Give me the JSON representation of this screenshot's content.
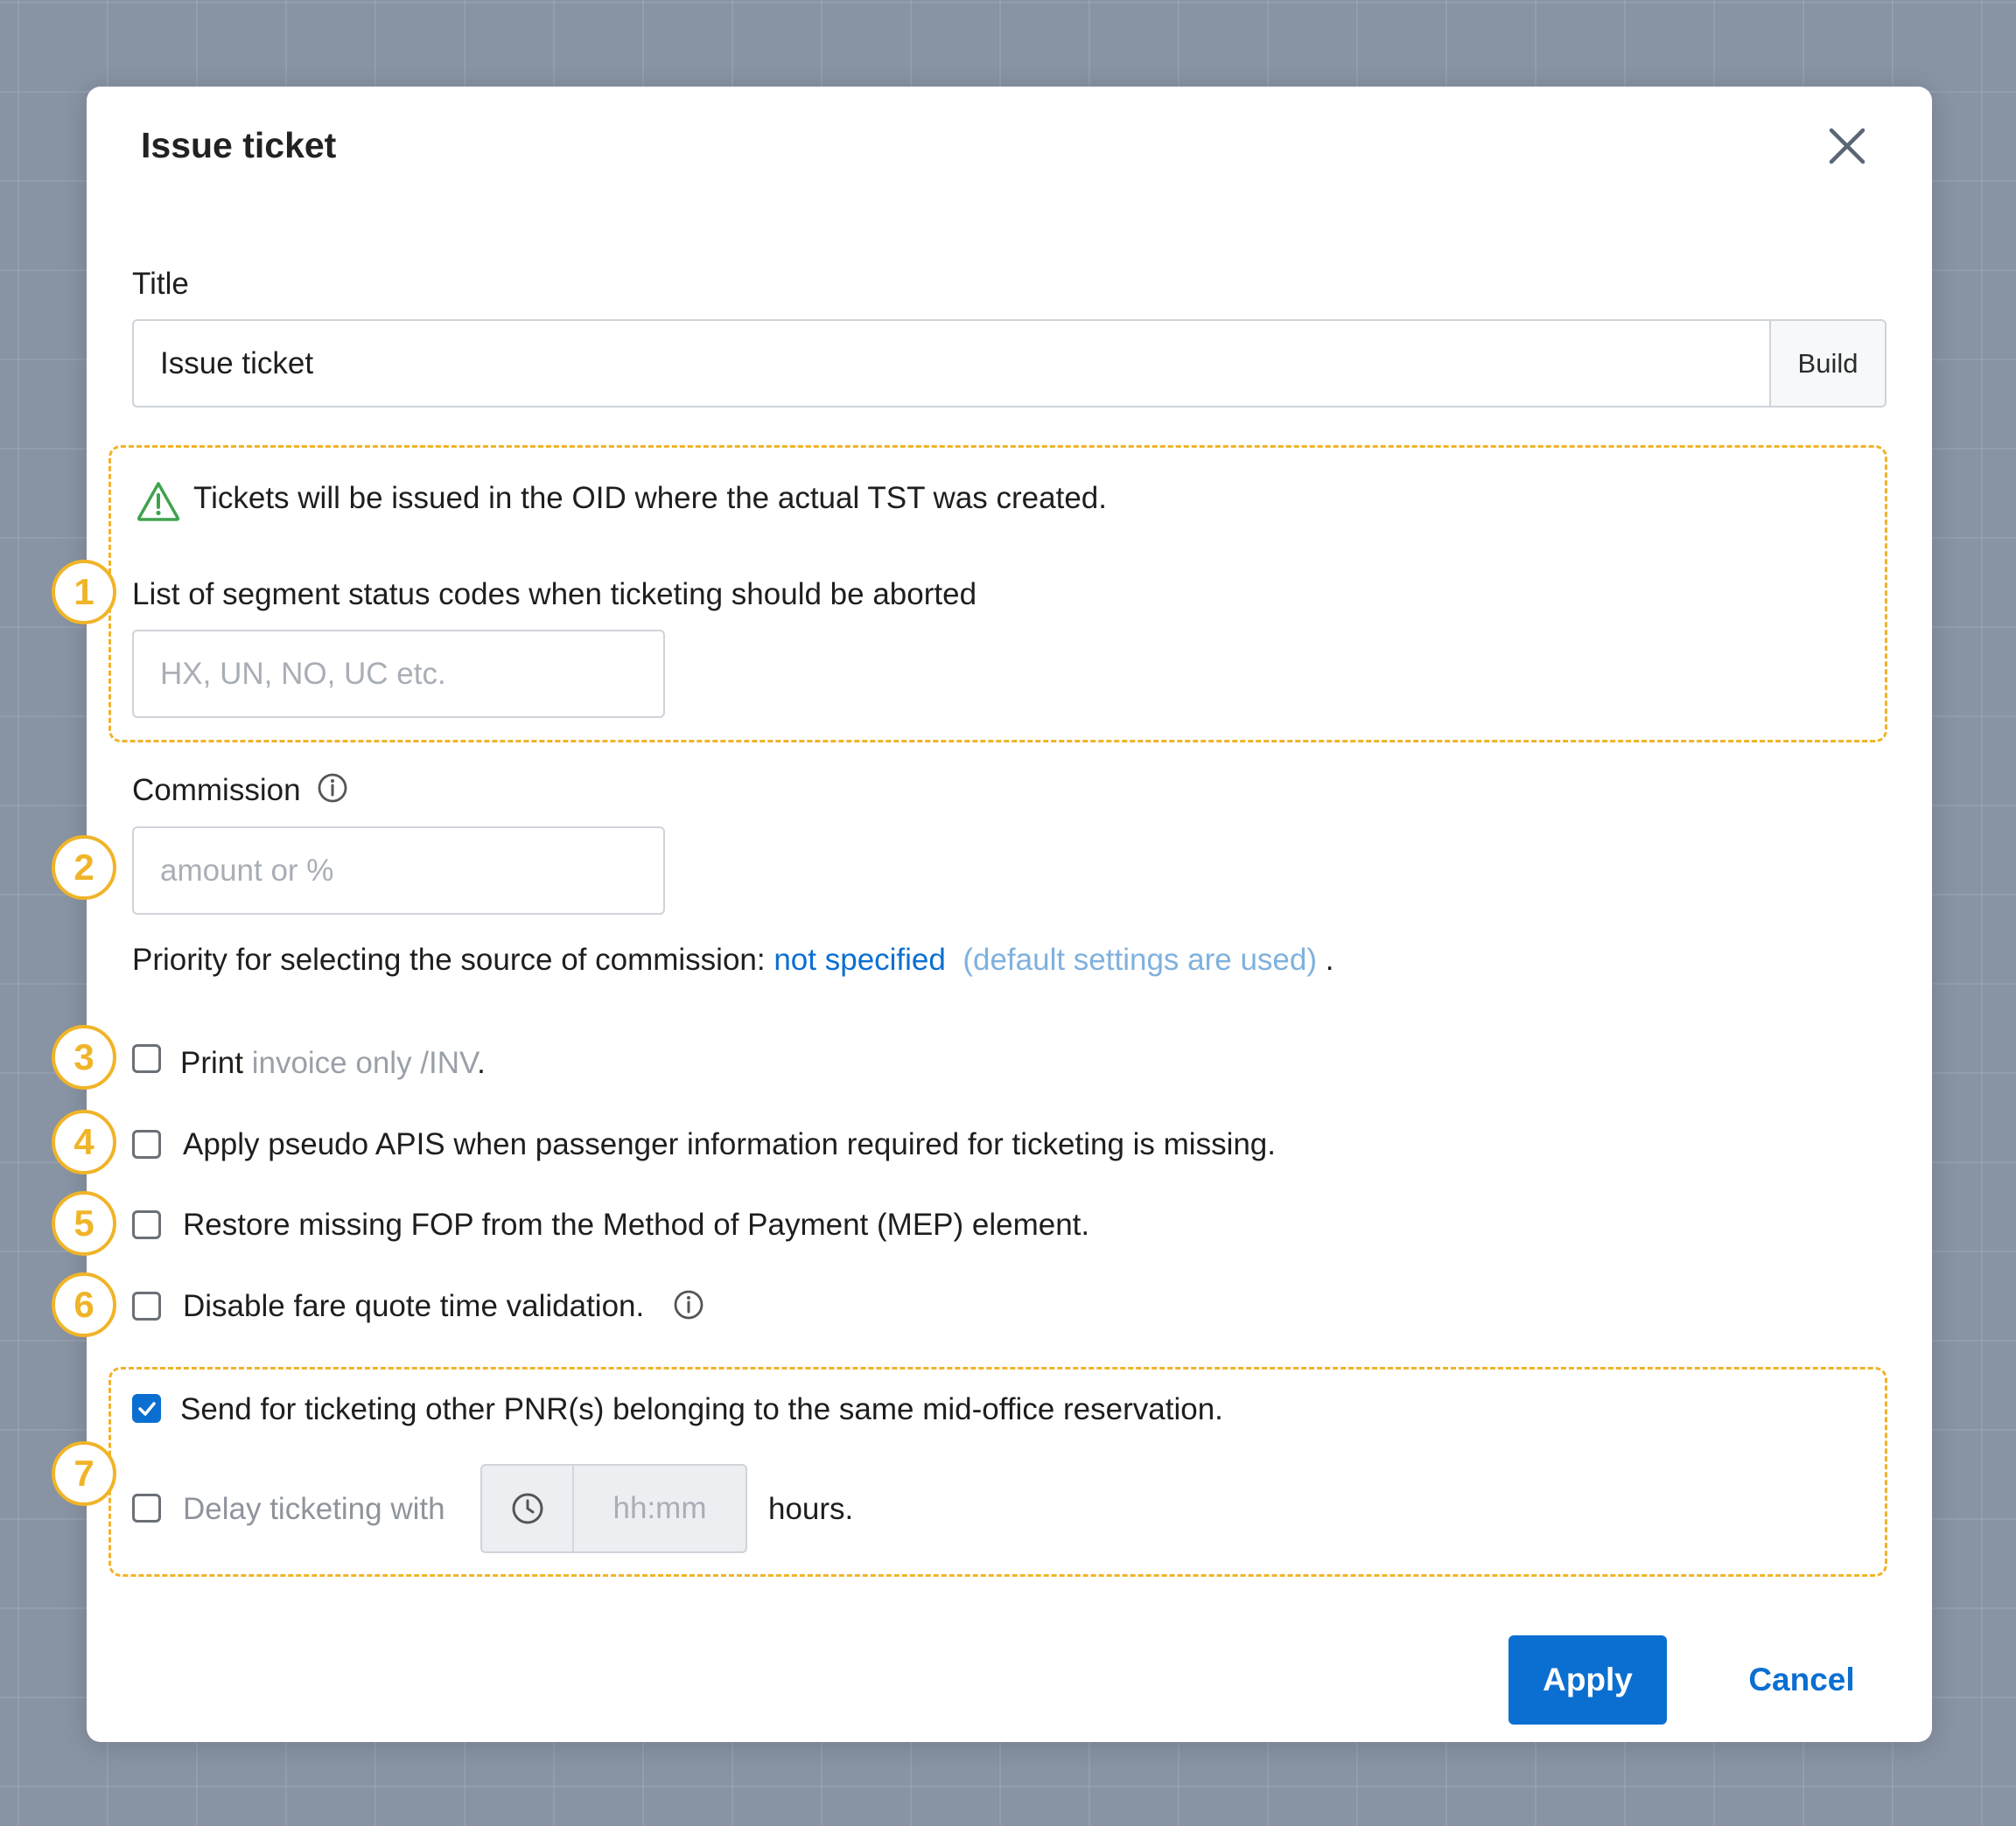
{
  "modal": {
    "title": "Issue ticket",
    "close_icon": "close-icon"
  },
  "title_field": {
    "label": "Title",
    "value": "Issue ticket",
    "build_label": "Build"
  },
  "notice": {
    "icon": "warning-triangle-icon",
    "text": "Tickets will be issued in the OID where the actual TST was created."
  },
  "segment_status": {
    "badge": "1",
    "label": "List of segment status codes when ticketing should be aborted",
    "placeholder": "HX, UN, NO, UC etc."
  },
  "commission": {
    "badge": "2",
    "label": "Commission",
    "info_icon": "info-icon",
    "placeholder": "amount or %",
    "priority_prefix": "Priority for selecting the source of commission:",
    "priority_link": "not specified",
    "priority_note": "(default settings are used)",
    "priority_suffix": "."
  },
  "options": {
    "print": {
      "badge": "3",
      "label": "Print",
      "muted": "invoice only /INV",
      "suffix": ".",
      "checked": false
    },
    "pseudo_apis": {
      "badge": "4",
      "label": "Apply pseudo APIS when passenger information required for ticketing is missing.",
      "checked": false
    },
    "restore_fop": {
      "badge": "5",
      "label": "Restore missing FOP from the Method of Payment (MEP) element.",
      "checked": false
    },
    "disable_fare_quote": {
      "badge": "6",
      "label": "Disable fare quote time validation.",
      "checked": false
    }
  },
  "mid_office": {
    "badge": "7",
    "send_label": "Send for ticketing other PNR(s) belonging to the same mid-office reservation.",
    "send_checked": true,
    "delay_label": "Delay ticketing with",
    "delay_checked": false,
    "time_placeholder": "hh:mm",
    "hours_label": "hours.",
    "clock_icon": "clock-icon"
  },
  "footer": {
    "apply_label": "Apply",
    "cancel_label": "Cancel"
  },
  "colors": {
    "accent": "#0b6fd1",
    "badge": "#f0b429",
    "notice_icon": "#3fa34d",
    "backdrop": "#8893a3"
  }
}
